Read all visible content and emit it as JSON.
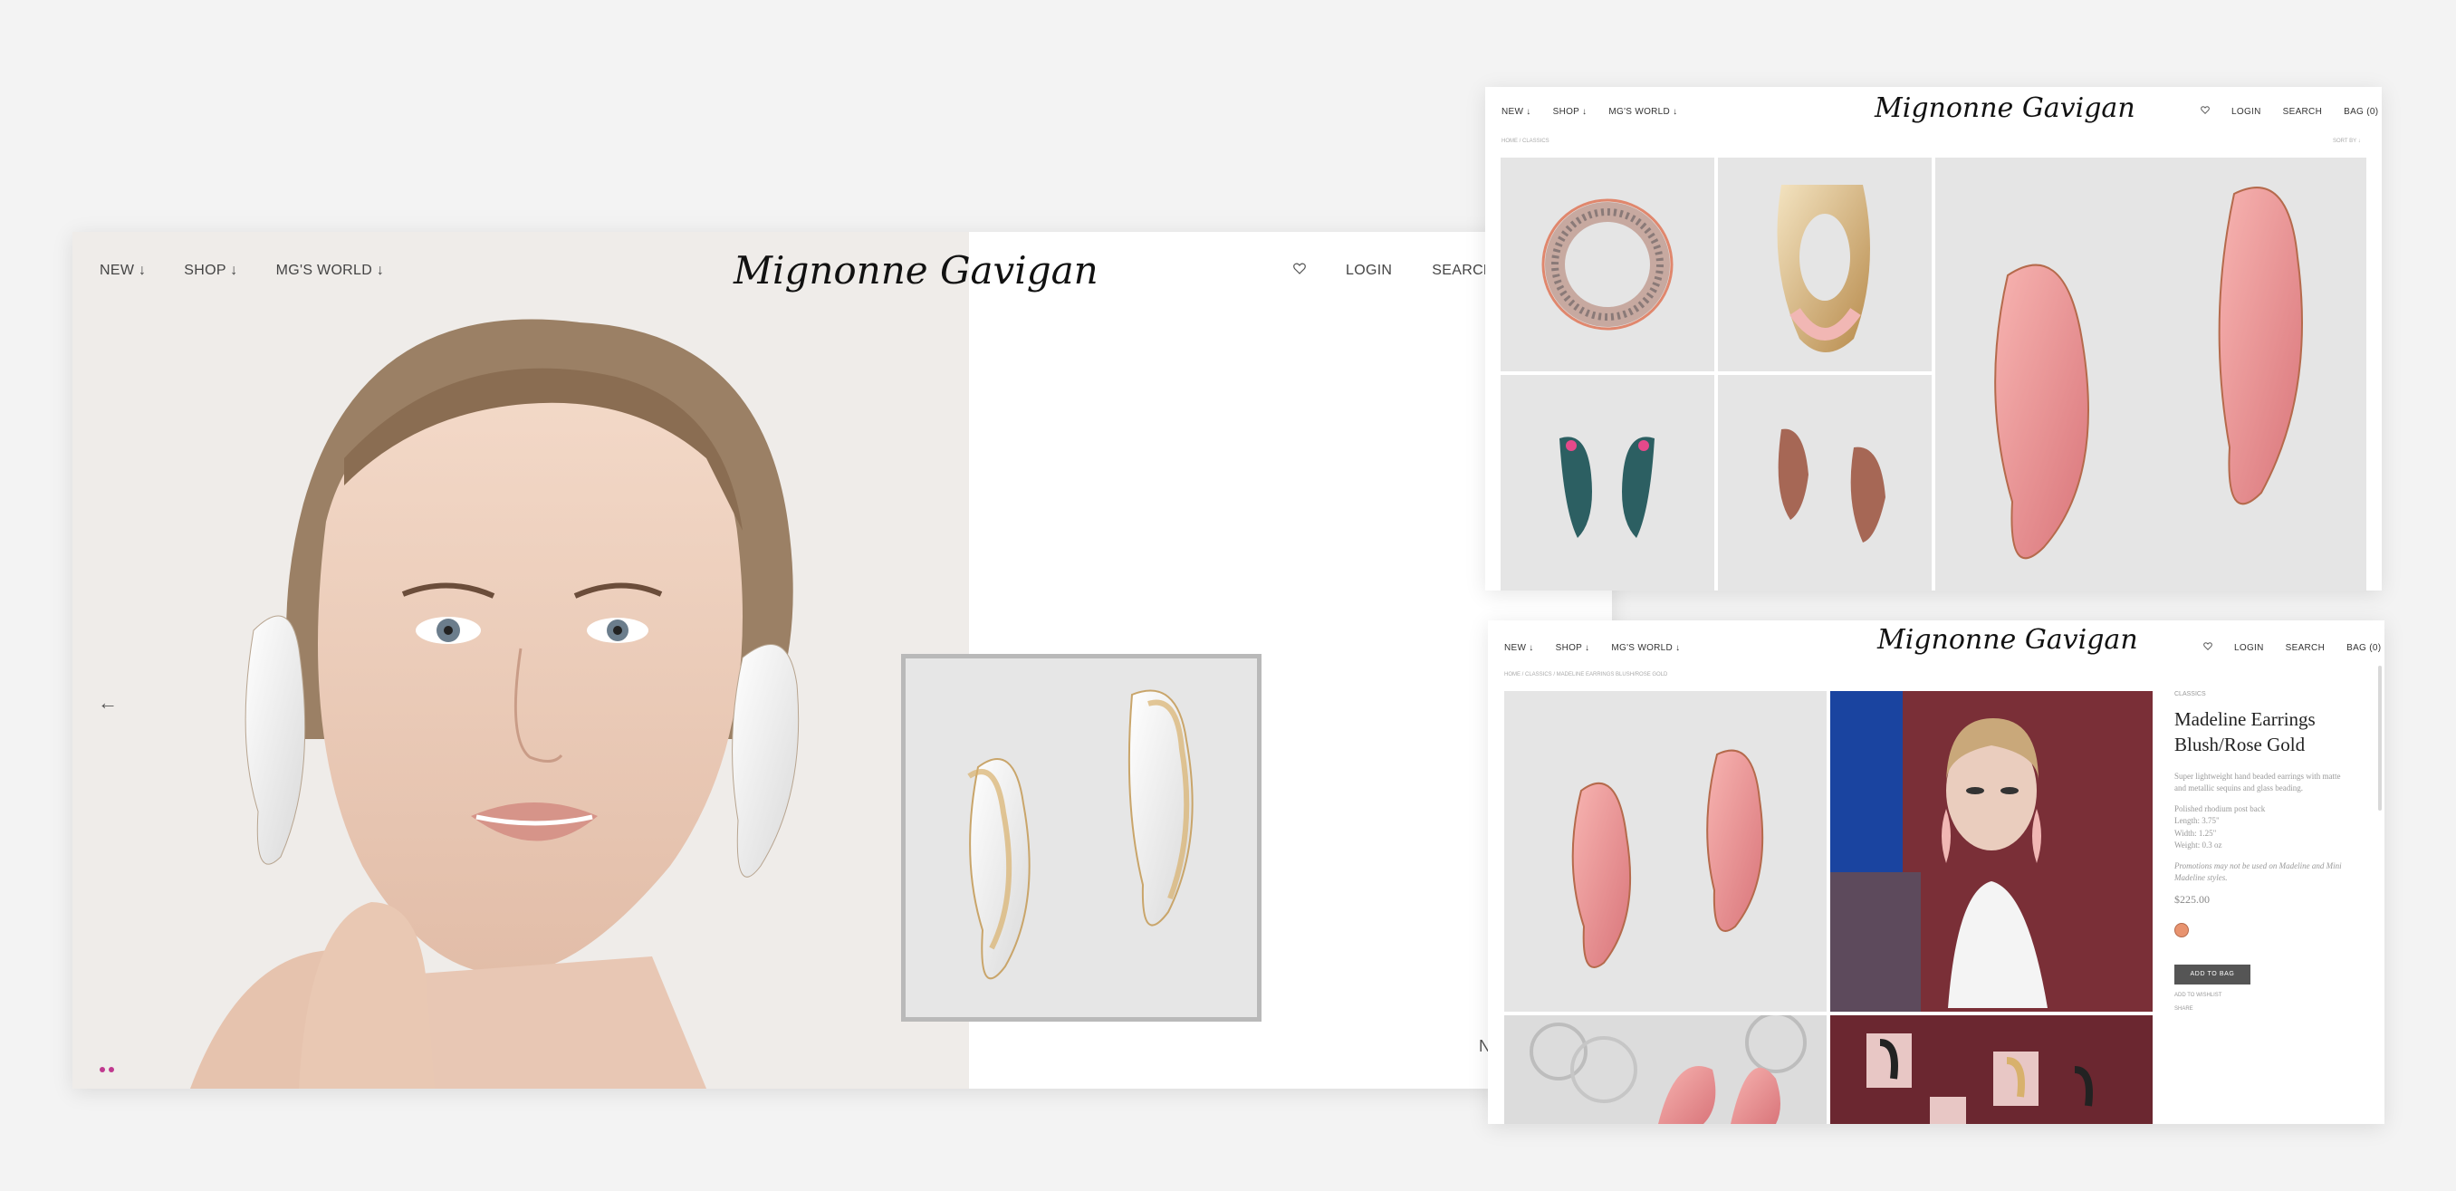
{
  "colors": {
    "page_background": "#f3f3f3",
    "accent_dots": "#c0398f",
    "tile_background": "#e5e5e5",
    "button": "#555555",
    "swatch_rose_gold": "#e8936f"
  },
  "main_window": {
    "nav": {
      "new": "NEW ↓",
      "shop": "SHOP ↓",
      "mgs_world": "MG'S WORLD ↓",
      "login": "LOGIN",
      "search": "SEARCH",
      "wishlist_icon": "heart-icon"
    },
    "logo": "Mignonne Gavigan",
    "prev_arrow": "←",
    "edge_letter": "N"
  },
  "grid_window": {
    "nav": {
      "new": "NEW ↓",
      "shop": "SHOP ↓",
      "mgs_world": "MG'S WORLD ↓",
      "login": "LOGIN",
      "search": "SEARCH",
      "bag": "BAG (0)",
      "wishlist_icon": "heart-icon"
    },
    "logo": "Mignonne Gavigan",
    "breadcrumb": "HOME / CLASSICS",
    "sort": "SORT BY ↓"
  },
  "detail_window": {
    "nav": {
      "new": "NEW ↓",
      "shop": "SHOP ↓",
      "mgs_world": "MG'S WORLD ↓",
      "login": "LOGIN",
      "search": "SEARCH",
      "bag": "BAG (0)",
      "wishlist_icon": "heart-icon"
    },
    "logo": "Mignonne Gavigan",
    "breadcrumb": "HOME / CLASSICS / MADELINE EARRINGS BLUSH/ROSE GOLD",
    "product": {
      "category": "CLASSICS",
      "title": "Madeline Earrings Blush/Rose Gold",
      "description": "Super lightweight hand beaded earrings with matte and metallic sequins and glass beading.",
      "specs": [
        "Polished rhodium post back",
        "Length: 3.75\"",
        "Width: 1.25\"",
        "Weight: 0.3 oz"
      ],
      "promo_note": "Promotions may not be used on Madeline and Mini Madeline styles.",
      "price": "$225.00",
      "add_to_bag": "ADD TO BAG",
      "add_to_wishlist": "ADD TO WISHLIST",
      "share": "SHARE"
    }
  }
}
